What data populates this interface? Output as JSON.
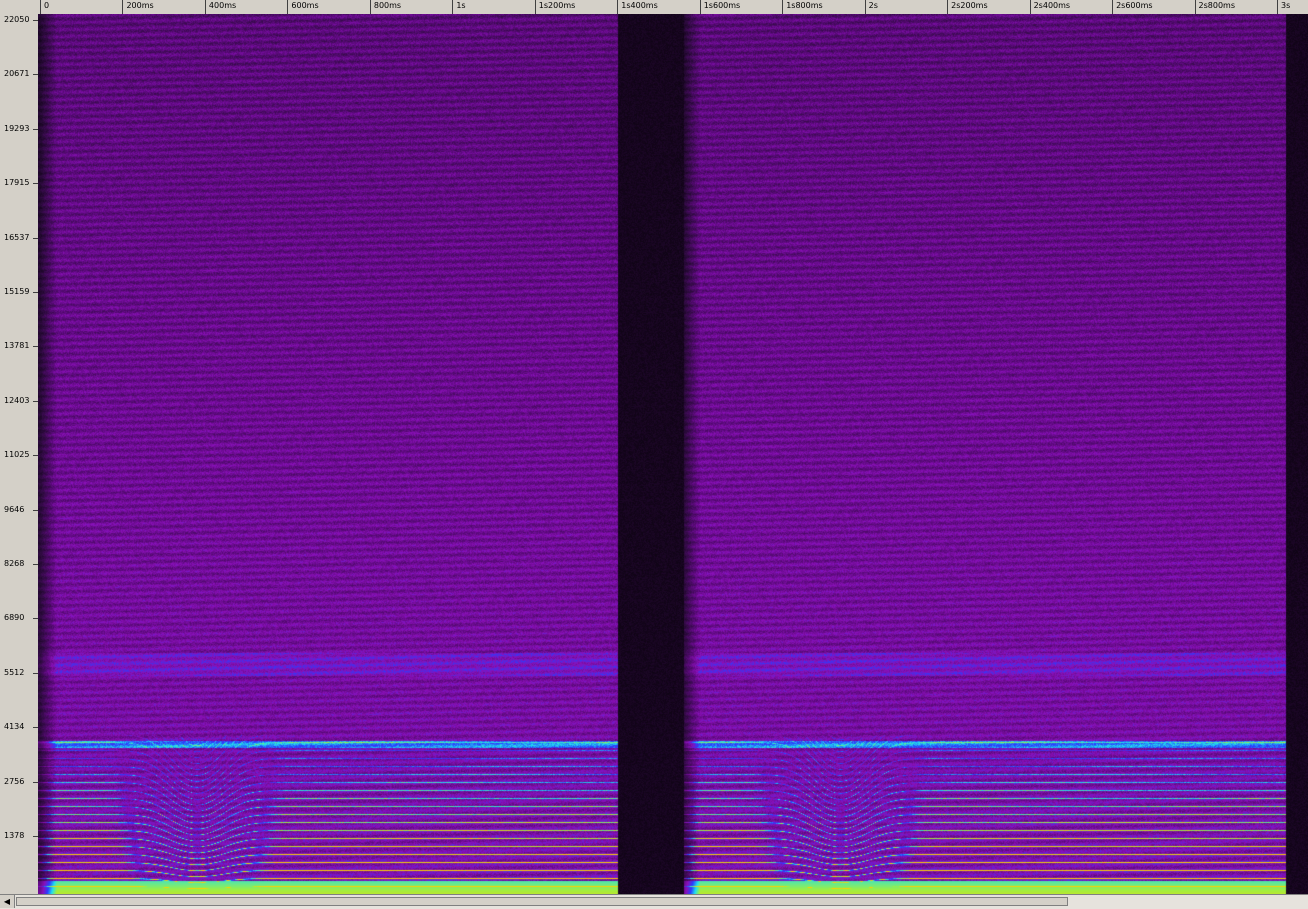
{
  "time_ruler": {
    "ticks": [
      {
        "label": "0",
        "t": 0.0
      },
      {
        "label": "200ms",
        "t": 0.2
      },
      {
        "label": "400ms",
        "t": 0.4
      },
      {
        "label": "600ms",
        "t": 0.6
      },
      {
        "label": "800ms",
        "t": 0.8
      },
      {
        "label": "1s",
        "t": 1.0
      },
      {
        "label": "1s200ms",
        "t": 1.2
      },
      {
        "label": "1s400ms",
        "t": 1.4
      },
      {
        "label": "1s600ms",
        "t": 1.6
      },
      {
        "label": "1s800ms",
        "t": 1.8
      },
      {
        "label": "2s",
        "t": 2.0
      },
      {
        "label": "2s200ms",
        "t": 2.2
      },
      {
        "label": "2s400ms",
        "t": 2.4
      },
      {
        "label": "2s600ms",
        "t": 2.6
      },
      {
        "label": "2s800ms",
        "t": 2.8
      },
      {
        "label": "3s",
        "t": 3.0
      }
    ]
  },
  "freq_ruler": {
    "unit": "Hz",
    "ticks": [
      "22050",
      "20671",
      "19293",
      "17915",
      "16537",
      "15159",
      "13781",
      "12403",
      "11025",
      "9646",
      "8268",
      "6890",
      "5512",
      "4134",
      "2756",
      "1378"
    ]
  },
  "spectrogram": {
    "colormap": [
      "#000000",
      "#2a0a3a",
      "#5a0a7a",
      "#8a10b8",
      "#2a3cff",
      "#20e0f0",
      "#a0f040",
      "#ffd000"
    ],
    "max_freq_hz": 22050,
    "silence_gap_s": [
      1.4,
      1.56
    ]
  },
  "scrollbar": {
    "left_arrow": "◀"
  }
}
